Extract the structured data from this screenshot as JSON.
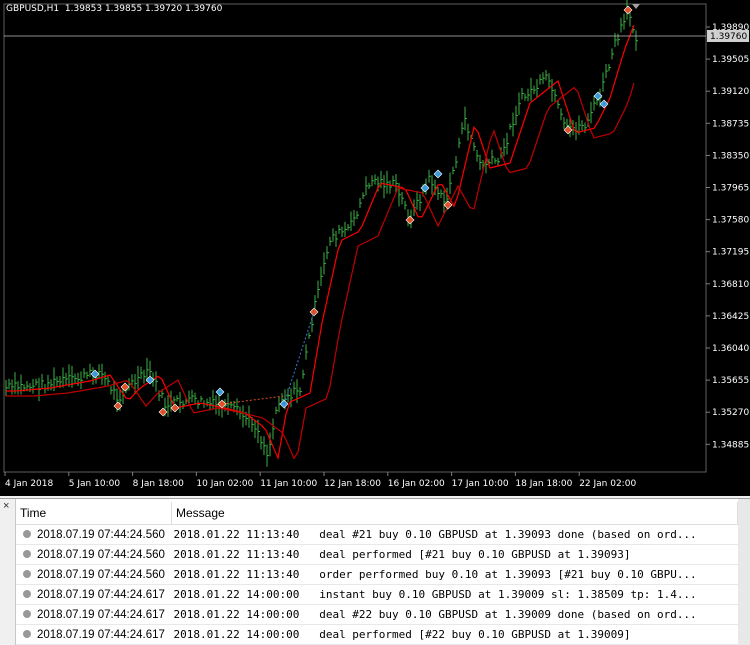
{
  "chart": {
    "symbol_header": "GBPUSD,H1  1.39853 1.39855 1.39720 1.39760",
    "current_price_label": "1.39760",
    "price_ticks": [
      "1.39890",
      "1.39505",
      "1.39120",
      "1.38735",
      "1.38350",
      "1.37965",
      "1.37580",
      "1.37195",
      "1.36810",
      "1.36425",
      "1.36040",
      "1.35655",
      "1.35270",
      "1.34885"
    ],
    "time_ticks": [
      "4 Jan 2018",
      "5 Jan 10:00",
      "8 Jan 18:00",
      "10 Jan 02:00",
      "11 Jan 10:00",
      "12 Jan 18:00",
      "16 Jan 02:00",
      "17 Jan 10:00",
      "18 Jan 18:00",
      "22 Jan 02:00"
    ],
    "colors": {
      "background": "#000000",
      "bars": "#3cb043",
      "ma_fast": "#ff0000",
      "ma_slow": "#c00000",
      "price_line": "#c0c0c0"
    }
  },
  "journal": {
    "columns": [
      "Time",
      "Message"
    ],
    "rows": [
      {
        "time": "2018.07.19 07:44:24.560",
        "message": "2018.01.22 11:13:40   deal #21 buy 0.10 GBPUSD at 1.39093 done (based on ord..."
      },
      {
        "time": "2018.07.19 07:44:24.560",
        "message": "2018.01.22 11:13:40   deal performed [#21 buy 0.10 GBPUSD at 1.39093]"
      },
      {
        "time": "2018.07.19 07:44:24.560",
        "message": "2018.01.22 11:13:40   order performed buy 0.10 at 1.39093 [#21 buy 0.10 GBPU..."
      },
      {
        "time": "2018.07.19 07:44:24.617",
        "message": "2018.01.22 14:00:00   instant buy 0.10 GBPUSD at 1.39009 sl: 1.38509 tp: 1.4..."
      },
      {
        "time": "2018.07.19 07:44:24.617",
        "message": "2018.01.22 14:00:00   deal #22 buy 0.10 GBPUSD at 1.39009 done (based on ord..."
      },
      {
        "time": "2018.07.19 07:44:24.617",
        "message": "2018.01.22 14:00:00   deal performed [#22 buy 0.10 GBPUSD at 1.39009]"
      }
    ]
  }
}
